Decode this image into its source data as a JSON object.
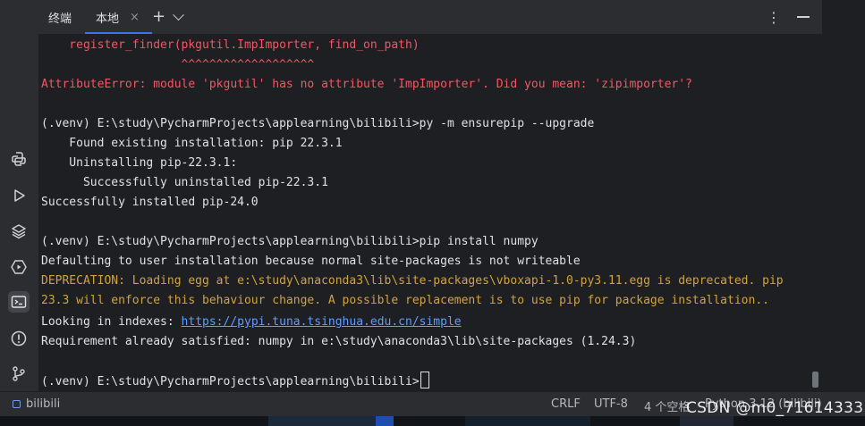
{
  "header": {
    "tab_terminal": "终端",
    "tab_local": "本地",
    "close": "×",
    "add": "+",
    "more": "⋮"
  },
  "terminal": {
    "lines": [
      {
        "text": "    register_finder(pkgutil.ImpImporter, find_on_path)",
        "color": "#f75464"
      },
      {
        "text": "                    ^^^^^^^^^^^^^^^^^^^",
        "color": "#f75464"
      },
      {
        "text": "AttributeError: module 'pkgutil' has no attribute 'ImpImporter'. Did you mean: 'zipimporter'?",
        "color": "#f75464"
      },
      {
        "text": "",
        "color": "#dfe1e5"
      },
      {
        "text": "(.venv) E:\\study\\PycharmProjects\\applearning\\bilibili>py -m ensurepip --upgrade",
        "color": "#dfe1e5"
      },
      {
        "text": "    Found existing installation: pip 22.3.1",
        "color": "#dfe1e5"
      },
      {
        "text": "    Uninstalling pip-22.3.1:",
        "color": "#dfe1e5"
      },
      {
        "text": "      Successfully uninstalled pip-22.3.1",
        "color": "#dfe1e5"
      },
      {
        "text": "Successfully installed pip-24.0",
        "color": "#dfe1e5"
      },
      {
        "text": "",
        "color": "#dfe1e5"
      },
      {
        "text": "(.venv) E:\\study\\PycharmProjects\\applearning\\bilibili>pip install numpy",
        "color": "#dfe1e5"
      },
      {
        "text": "Defaulting to user installation because normal site-packages is not writeable",
        "color": "#dfe1e5"
      },
      {
        "text": "DEPRECATION: Loading egg at e:\\study\\anaconda3\\lib\\site-packages\\vboxapi-1.0-py3.11.egg is deprecated. pip",
        "color": "#d1a33f"
      },
      {
        "text": "23.3 will enforce this behaviour change. A possible replacement is to use pip for package installation..",
        "color": "#d1a33f"
      }
    ],
    "index_prefix": "Looking in indexes: ",
    "index_url": "https://pypi.tuna.tsinghua.edu.cn/simple",
    "requirement": "Requirement already satisfied: numpy in e:\\study\\anaconda3\\lib\\site-packages (1.24.3)",
    "prompt": "(.venv) E:\\study\\PycharmProjects\\applearning\\bilibili>"
  },
  "leftbar": {
    "icons": [
      "python-console-icon",
      "run-icon",
      "layers-icon",
      "services-icon",
      "terminal-icon",
      "problems-icon",
      "git-icon"
    ],
    "active": "terminal-icon"
  },
  "statusbar": {
    "project": "bilibili",
    "line_ending": "CRLF",
    "encoding": "UTF-8",
    "indent": "4 个空格",
    "interpreter": "Python 3.12 (bilibili)"
  },
  "watermark": "CSDN @m0_71614333",
  "colors": {
    "error": "#f75464",
    "warning": "#d1a33f",
    "link": "#5c9eff",
    "accent": "#3574f0"
  }
}
